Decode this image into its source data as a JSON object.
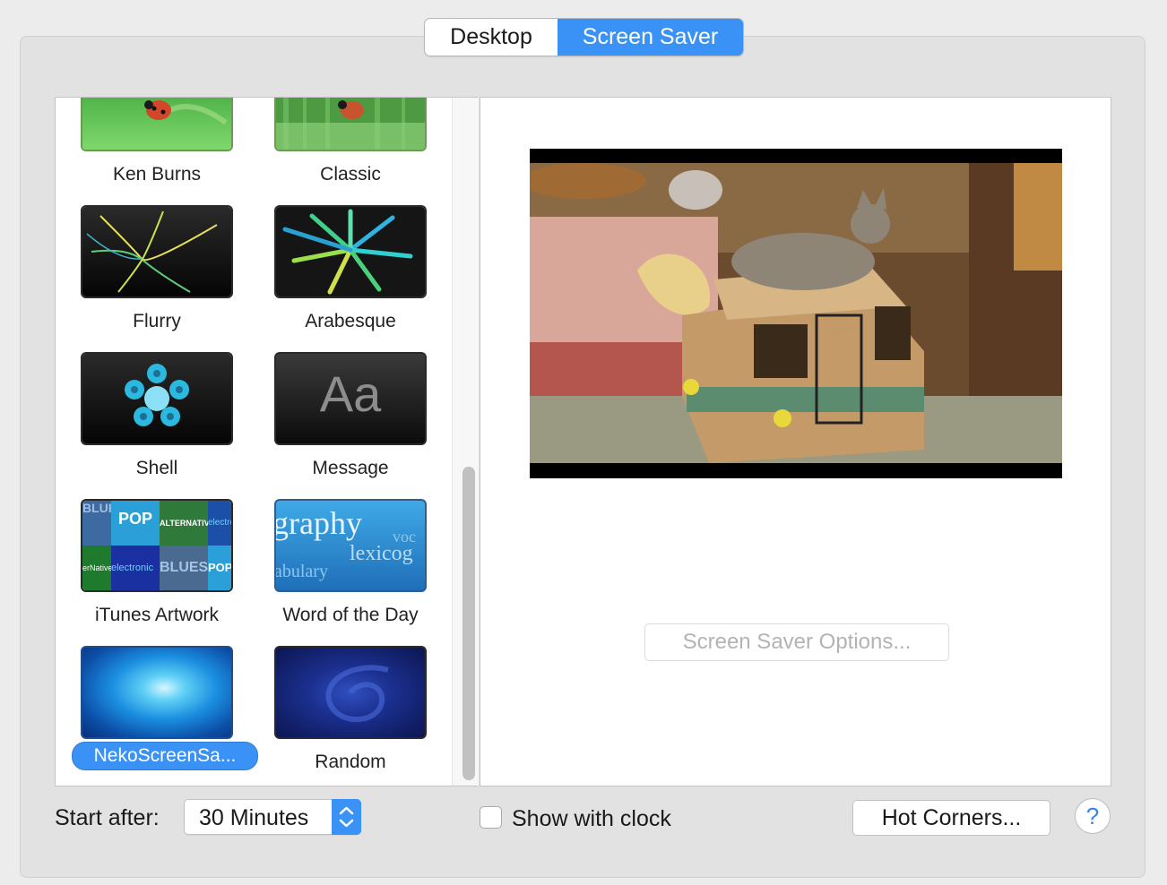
{
  "tabs": [
    {
      "label": "Desktop",
      "active": false
    },
    {
      "label": "Screen Saver",
      "active": true
    }
  ],
  "savers": [
    {
      "label": "Ken Burns",
      "icon": "ken-burns-thumbnail"
    },
    {
      "label": "Classic",
      "icon": "classic-thumbnail"
    },
    {
      "label": "Flurry",
      "icon": "flurry-thumbnail"
    },
    {
      "label": "Arabesque",
      "icon": "arabesque-thumbnail"
    },
    {
      "label": "Shell",
      "icon": "shell-thumbnail"
    },
    {
      "label": "Message",
      "icon": "message-thumbnail",
      "glyph": "Aa"
    },
    {
      "label": "iTunes Artwork",
      "icon": "itunes-artwork-thumbnail",
      "tiles": [
        "BLUES",
        "POP",
        "ALTERNATIVE",
        "electronic",
        "erNative",
        "electronic",
        "BLUES",
        "POP"
      ]
    },
    {
      "label": "Word of the Day",
      "icon": "word-of-the-day-thumbnail",
      "words": [
        "graphy",
        "voc",
        "lexicog",
        "abulary"
      ]
    },
    {
      "label": "NekoScreenSa...",
      "icon": "neko-thumbnail",
      "selected": true
    },
    {
      "label": "Random",
      "icon": "random-thumbnail"
    }
  ],
  "preview": {
    "options_label": "Screen Saver Options..."
  },
  "bottom": {
    "start_after_label": "Start after:",
    "start_after_value": "30 Minutes",
    "show_clock_label": "Show with clock",
    "show_clock_checked": false,
    "hot_corners_label": "Hot Corners...",
    "help_label": "?"
  },
  "colors": {
    "accent": "#3b92f6",
    "panel_bg": "#e2e2e2",
    "window_bg": "#ececec"
  }
}
